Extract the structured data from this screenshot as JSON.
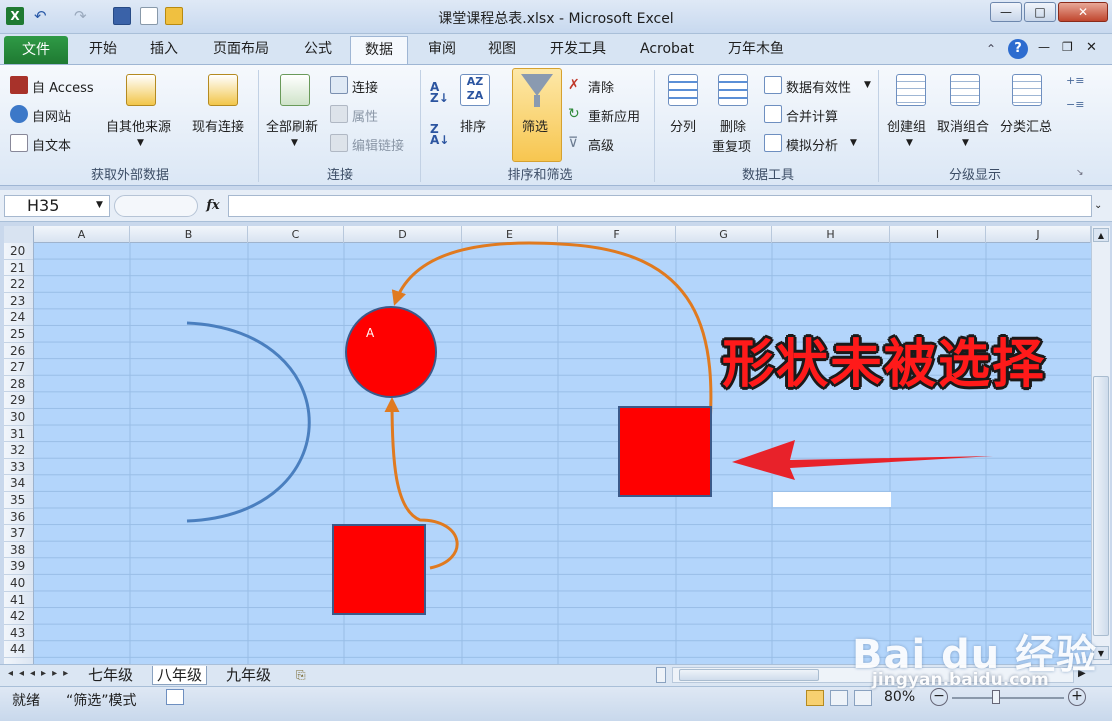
{
  "window": {
    "title": "课堂课程总表.xlsx - Microsoft Excel",
    "min": "—",
    "max": "□",
    "close": "✕"
  },
  "tabs": {
    "file": "文件",
    "items": [
      "开始",
      "插入",
      "页面布局",
      "公式",
      "数据",
      "审阅",
      "视图",
      "开发工具",
      "Acrobat",
      "万年木鱼"
    ],
    "active": "数据"
  },
  "ribbon": {
    "get_external": {
      "access": "自 Access",
      "web": "自网站",
      "text": "自文本",
      "other": "自其他来源",
      "existing": "现有连接",
      "label": "获取外部数据"
    },
    "connections": {
      "refresh_all": "全部刷新",
      "connections": "连接",
      "properties": "属性",
      "edit_links": "编辑链接",
      "label": "连接"
    },
    "sort_filter": {
      "sort": "排序",
      "filter": "筛选",
      "clear": "清除",
      "reapply": "重新应用",
      "advanced": "高级",
      "label": "排序和筛选"
    },
    "data_tools": {
      "text_to_cols": "分列",
      "remove_dup_1": "删除",
      "remove_dup_2": "重复项",
      "validation": "数据有效性",
      "consolidate": "合并计算",
      "whatif": "模拟分析",
      "label": "数据工具"
    },
    "outline": {
      "group": "创建组",
      "ungroup": "取消组合",
      "subtotal": "分类汇总",
      "label": "分级显示"
    }
  },
  "formula_bar": {
    "name_box": "H35",
    "fx": "fx",
    "formula": ""
  },
  "columns": [
    "A",
    "B",
    "C",
    "D",
    "E",
    "F",
    "G",
    "H",
    "I",
    "J"
  ],
  "rows": [
    "20",
    "21",
    "22",
    "23",
    "24",
    "25",
    "26",
    "27",
    "28",
    "29",
    "30",
    "31",
    "32",
    "33",
    "34",
    "35",
    "36",
    "37",
    "38",
    "39",
    "40",
    "41",
    "42",
    "43",
    "44"
  ],
  "shapes": {
    "circle_label": "A"
  },
  "annotation": "形状未被选择",
  "sheets": {
    "items": [
      "七年级",
      "八年级",
      "九年级"
    ],
    "active": "八年级"
  },
  "status": {
    "ready": "就绪",
    "mode": "“筛选”模式",
    "zoom": "80%"
  },
  "watermark": {
    "brand": "Bai du 经验",
    "url": "jingyan.baidu.com"
  },
  "colors": {
    "shape_red": "#ff0000",
    "arrow_orange": "#e07a1f",
    "arc_blue": "#4a7fbf",
    "grid_bg": "#b3d5fb"
  }
}
